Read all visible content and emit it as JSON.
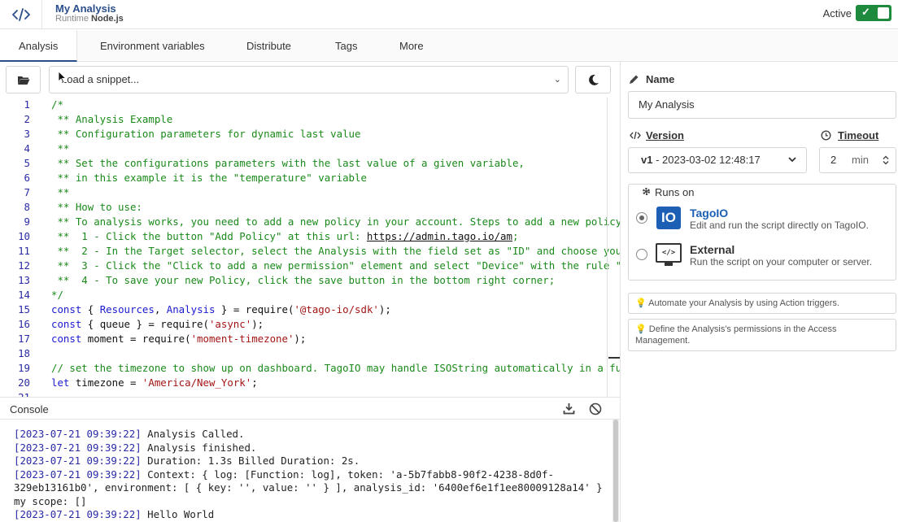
{
  "header": {
    "title": "My Analysis",
    "runtime_label": "Runtime",
    "runtime_value": "Node.js",
    "active_label": "Active",
    "active_check": "✓"
  },
  "tabs": [
    "Analysis",
    "Environment variables",
    "Distribute",
    "Tags",
    "More"
  ],
  "editor": {
    "snippet_placeholder": "Load a snippet...",
    "snippet_chevron": "⌄",
    "lines": [
      {
        "n": "1",
        "parts": [
          {
            "c": "c",
            "t": "/*"
          }
        ]
      },
      {
        "n": "2",
        "parts": [
          {
            "c": "c",
            "t": " ** Analysis Example"
          }
        ]
      },
      {
        "n": "3",
        "parts": [
          {
            "c": "c",
            "t": " ** Configuration parameters for dynamic last value"
          }
        ]
      },
      {
        "n": "4",
        "parts": [
          {
            "c": "c",
            "t": " **"
          }
        ]
      },
      {
        "n": "5",
        "parts": [
          {
            "c": "c",
            "t": " ** Set the configurations parameters with the last value of a given variable,"
          }
        ]
      },
      {
        "n": "6",
        "parts": [
          {
            "c": "c",
            "t": " ** in this example it is the \"temperature\" variable"
          }
        ]
      },
      {
        "n": "7",
        "parts": [
          {
            "c": "c",
            "t": " **"
          }
        ]
      },
      {
        "n": "8",
        "parts": [
          {
            "c": "c",
            "t": " ** How to use:"
          }
        ]
      },
      {
        "n": "9",
        "parts": [
          {
            "c": "c",
            "t": " ** To analysis works, you need to add a new policy in your account. Steps to add a new policy:"
          }
        ]
      },
      {
        "n": "10",
        "parts": [
          {
            "c": "c",
            "t": " **  1 - Click the button \"Add Policy\" at this url: "
          },
          {
            "c": "u",
            "t": "https://admin.tago.io/am"
          },
          {
            "c": "c",
            "t": ";"
          }
        ]
      },
      {
        "n": "11",
        "parts": [
          {
            "c": "c",
            "t": " **  2 - In the Target selector, select the Analysis with the field set as \"ID\" and choose your"
          }
        ]
      },
      {
        "n": "12",
        "parts": [
          {
            "c": "c",
            "t": " **  3 - Click the \"Click to add a new permission\" element and select \"Device\" with the rule \"Acc"
          }
        ]
      },
      {
        "n": "13",
        "parts": [
          {
            "c": "c",
            "t": " **  4 - To save your new Policy, click the save button in the bottom right corner;"
          }
        ]
      },
      {
        "n": "14",
        "parts": [
          {
            "c": "c",
            "t": "*/"
          }
        ]
      },
      {
        "n": "15",
        "parts": [
          {
            "c": "k",
            "t": "const"
          },
          {
            "c": "t",
            "t": " { "
          },
          {
            "c": "k",
            "t": "Resources"
          },
          {
            "c": "t",
            "t": ", "
          },
          {
            "c": "k",
            "t": "Analysis"
          },
          {
            "c": "t",
            "t": " } = require("
          },
          {
            "c": "s",
            "t": "'@tago-io/sdk'"
          },
          {
            "c": "t",
            "t": ");"
          }
        ]
      },
      {
        "n": "16",
        "parts": [
          {
            "c": "k",
            "t": "const"
          },
          {
            "c": "t",
            "t": " { queue } = require("
          },
          {
            "c": "s",
            "t": "'async'"
          },
          {
            "c": "t",
            "t": ");"
          }
        ]
      },
      {
        "n": "17",
        "parts": [
          {
            "c": "k",
            "t": "const"
          },
          {
            "c": "t",
            "t": " moment = require("
          },
          {
            "c": "s",
            "t": "'moment-timezone'"
          },
          {
            "c": "t",
            "t": ");"
          }
        ]
      },
      {
        "n": "18",
        "parts": [
          {
            "c": "t",
            "t": ""
          }
        ]
      },
      {
        "n": "19",
        "parts": [
          {
            "c": "c",
            "t": "// set the timezone to show up on dashboard. TagoIO may handle ISOString automatically in a future"
          }
        ]
      },
      {
        "n": "20",
        "parts": [
          {
            "c": "k",
            "t": "let"
          },
          {
            "c": "t",
            "t": " timezone = "
          },
          {
            "c": "s",
            "t": "'America/New_York'"
          },
          {
            "c": "t",
            "t": ";"
          }
        ]
      },
      {
        "n": "21",
        "parts": [
          {
            "c": "t",
            "t": ""
          }
        ]
      }
    ]
  },
  "console": {
    "title": "Console",
    "lines": [
      {
        "ts": "[2023-07-21 09:39:22]",
        "text": " Analysis Called."
      },
      {
        "ts": "[2023-07-21 09:39:22]",
        "text": " Analysis finished."
      },
      {
        "ts": "[2023-07-21 09:39:22]",
        "text": " Duration: 1.3s Billed Duration: 2s."
      },
      {
        "ts": "[2023-07-21 09:39:22]",
        "text": " Context: { log: [Function: log], token: 'a-5b7fabb8-90f2-4238-8d0f-"
      },
      {
        "ts": "",
        "text": "329eb13161b0', environment: [ { key: '', value: '' } ], analysis_id: '6400ef6e1f1ee80009128a14' }"
      },
      {
        "ts": "",
        "text": "my scope: []"
      },
      {
        "ts": "[2023-07-21 09:39:22]",
        "text": " Hello World"
      }
    ]
  },
  "panel": {
    "name_label": "Name",
    "name_value": "My Analysis",
    "version_label": "Version",
    "version_value": "v1",
    "version_date": " - 2023-03-02 12:48:17",
    "timeout_label": "Timeout",
    "timeout_value": "2",
    "timeout_unit": "min",
    "runs_on_label": "Runs on",
    "options": [
      {
        "title": "TagoIO",
        "desc": "Edit and run the script directly on TagoIO.",
        "icon_text": "IO",
        "selected": true
      },
      {
        "title": "External",
        "desc": "Run the script on your computer or server.",
        "icon_text": "</>",
        "selected": false
      }
    ],
    "hint_1": "Automate your Analysis by using Action triggers.",
    "hint_2": "Define the Analysis's permissions in the Access Management."
  },
  "colors": {
    "accent": "#2c4f8c",
    "toggle": "#1e8a3e",
    "tagoio_blue": "#1c5fb5"
  }
}
